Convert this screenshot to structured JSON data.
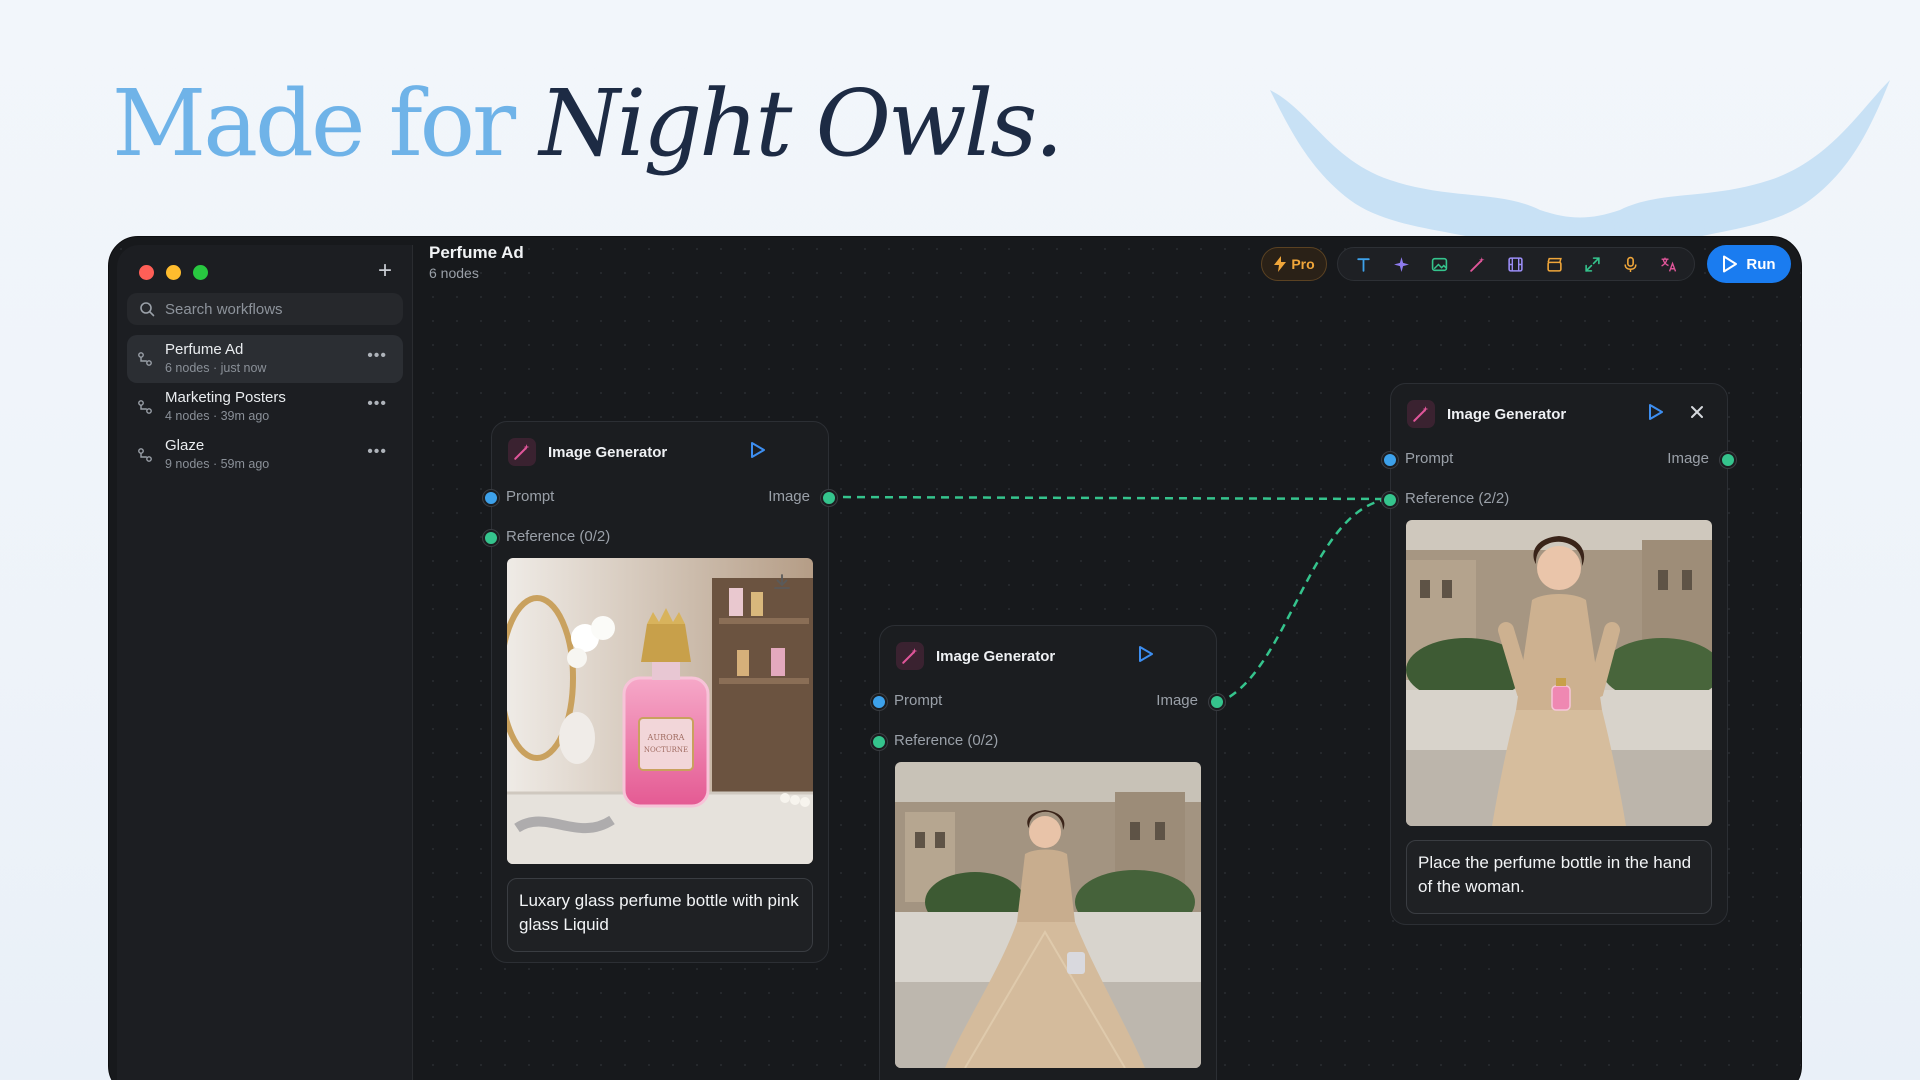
{
  "hero": {
    "lead": "Made for ",
    "emphasis": "Night Owls."
  },
  "sidebar": {
    "search_placeholder": "Search workflows",
    "items": [
      {
        "title": "Perfume Ad",
        "meta": "6 nodes · just now"
      },
      {
        "title": "Marketing Posters",
        "meta": "4 nodes · 39m ago"
      },
      {
        "title": "Glaze",
        "meta": "9 nodes · 59m ago"
      }
    ]
  },
  "document": {
    "title": "Perfume Ad",
    "subtitle": "6 nodes"
  },
  "toolbar": {
    "pro_label": "Pro",
    "run_label": "Run",
    "tools": [
      "text-icon",
      "sparkle-icon",
      "image-icon",
      "wand-icon",
      "film-icon",
      "clapper-icon",
      "expand-icon",
      "mic-icon",
      "translate-icon"
    ]
  },
  "nodes": [
    {
      "title": "Image Generator",
      "input_prompt": "Prompt",
      "input_reference": "Reference (0/2)",
      "output": "Image",
      "prompt_text": "Luxary glass perfume bottle with pink glass Liquid"
    },
    {
      "title": "Image Generator",
      "input_prompt": "Prompt",
      "input_reference": "Reference (0/2)",
      "output": "Image"
    },
    {
      "title": "Image Generator",
      "input_prompt": "Prompt",
      "input_reference": "Reference (2/2)",
      "output": "Image",
      "prompt_text": "Place the perfume bottle in the hand of the woman."
    }
  ],
  "colors": {
    "accent": "#1a7cf0",
    "wire": "#35c48d",
    "port_prompt": "#3da1ea",
    "port_reference": "#35c48d",
    "pro": "#f0a63a",
    "hero_light": "#6fb3e8",
    "hero_dark": "#1d2b44"
  }
}
